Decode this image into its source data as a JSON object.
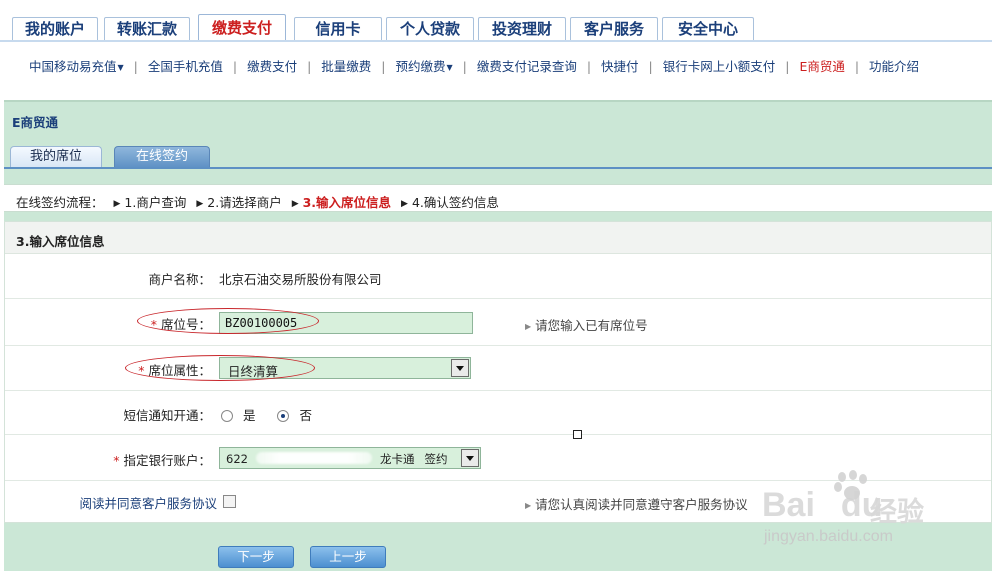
{
  "topnav": {
    "tabs": [
      {
        "label": "我的账户"
      },
      {
        "label": "转账汇款"
      },
      {
        "label": "缴费支付",
        "active": true
      },
      {
        "label": "信用卡"
      },
      {
        "label": "个人贷款"
      },
      {
        "label": "投资理财"
      },
      {
        "label": "客户服务"
      },
      {
        "label": "安全中心"
      }
    ]
  },
  "subnav": {
    "items": [
      {
        "label": "中国移动易充值",
        "dropdown": true
      },
      {
        "label": "全国手机充值"
      },
      {
        "label": "缴费支付"
      },
      {
        "label": "批量缴费"
      },
      {
        "label": "预约缴费",
        "dropdown": true
      },
      {
        "label": "缴费支付记录查询"
      },
      {
        "label": "快捷付"
      },
      {
        "label": "银行卡网上小额支付"
      },
      {
        "label": "E商贸通",
        "current": true
      },
      {
        "label": "功能介绍"
      }
    ]
  },
  "module": {
    "title": "E商贸通",
    "tabs": {
      "my_seat": "我的席位",
      "online_sign": "在线签约"
    }
  },
  "flow": {
    "label": "在线签约流程：",
    "steps": [
      "1.商户查询",
      "2.请选择商户",
      "3.输入席位信息",
      "4.确认签约信息"
    ],
    "current_step": 3
  },
  "form": {
    "section_title": "3.输入席位信息",
    "merchant": {
      "label": "商户名称：",
      "value": "北京石油交易所股份有限公司"
    },
    "seat_no": {
      "label": "席位号：",
      "value": "BZ00100005",
      "hint": "请您输入已有席位号"
    },
    "seat_attr": {
      "label": "席位属性：",
      "value": "日终清算"
    },
    "sms": {
      "label": "短信通知开通：",
      "option_yes": "是",
      "option_no": "否",
      "selected": "否"
    },
    "bank_account": {
      "label": "指定银行账户：",
      "prefix": "622",
      "card_type": "龙卡通",
      "status": "签约"
    },
    "agreement": {
      "label": "阅读并同意客户服务协议",
      "hint": "请您认真阅读并同意遵守客户服务协议"
    }
  },
  "buttons": {
    "next": "下一步",
    "prev": "上一步"
  },
  "watermark": {
    "brand": "Bai",
    "brand2": "du",
    "jingyan": "经验",
    "url": "jingyan.baidu.com"
  },
  "colors": {
    "accent_red": "#cc1f1f",
    "nav_blue": "#1b3f7a",
    "module_green": "#cbe7d6",
    "input_green": "#d8f0dc"
  }
}
